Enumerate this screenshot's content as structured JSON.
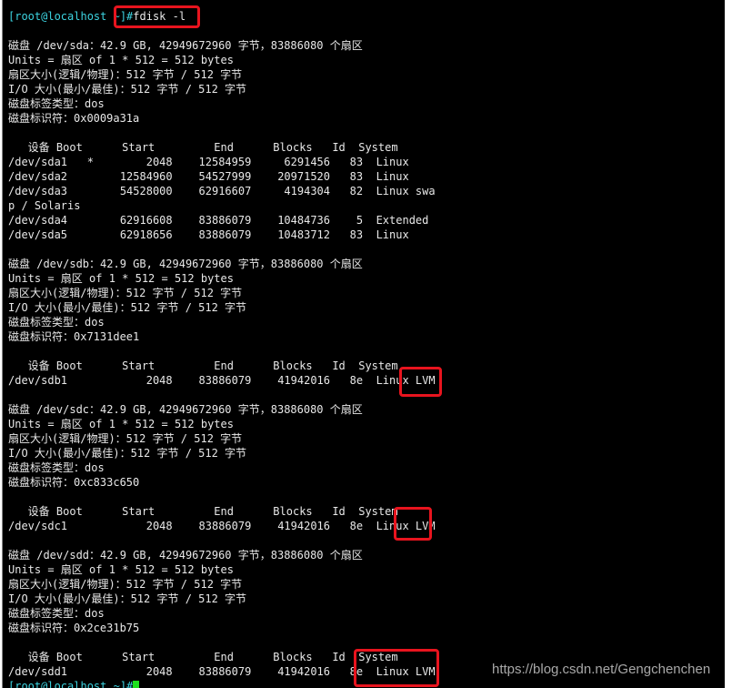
{
  "terminal": {
    "prompt": "[root@localhost ~]#",
    "command": "fdisk -l",
    "lines": [
      "磁盘 /dev/sda：42.9 GB, 42949672960 字节，83886080 个扇区",
      "Units = 扇区 of 1 * 512 = 512 bytes",
      "扇区大小(逻辑/物理)：512 字节 / 512 字节",
      "I/O 大小(最小/最佳)：512 字节 / 512 字节",
      "磁盘标签类型：dos",
      "磁盘标识符：0x0009a31a",
      "",
      "   设备 Boot      Start         End      Blocks   Id  System",
      "/dev/sda1   *        2048    12584959     6291456   83  Linux",
      "/dev/sda2        12584960    54527999    20971520   83  Linux",
      "/dev/sda3        54528000    62916607     4194304   82  Linux swa",
      "p / Solaris",
      "/dev/sda4        62916608    83886079    10484736    5  Extended",
      "/dev/sda5        62918656    83886079    10483712   83  Linux",
      "",
      "磁盘 /dev/sdb：42.9 GB, 42949672960 字节，83886080 个扇区",
      "Units = 扇区 of 1 * 512 = 512 bytes",
      "扇区大小(逻辑/物理)：512 字节 / 512 字节",
      "I/O 大小(最小/最佳)：512 字节 / 512 字节",
      "磁盘标签类型：dos",
      "磁盘标识符：0x7131dee1",
      "",
      "   设备 Boot      Start         End      Blocks   Id  System",
      "/dev/sdb1            2048    83886079    41942016   8e  Linux LVM",
      "",
      "磁盘 /dev/sdc：42.9 GB, 42949672960 字节，83886080 个扇区",
      "Units = 扇区 of 1 * 512 = 512 bytes",
      "扇区大小(逻辑/物理)：512 字节 / 512 字节",
      "I/O 大小(最小/最佳)：512 字节 / 512 字节",
      "磁盘标签类型：dos",
      "磁盘标识符：0xc833c650",
      "",
      "   设备 Boot      Start         End      Blocks   Id  System",
      "/dev/sdc1            2048    83886079    41942016   8e  Linux LVM",
      "",
      "磁盘 /dev/sdd：42.9 GB, 42949672960 字节，83886080 个扇区",
      "Units = 扇区 of 1 * 512 = 512 bytes",
      "扇区大小(逻辑/物理)：512 字节 / 512 字节",
      "I/O 大小(最小/最佳)：512 字节 / 512 字节",
      "磁盘标签类型：dos",
      "磁盘标识符：0x2ce31b75",
      "",
      "   设备 Boot      Start         End      Blocks   Id  System",
      "/dev/sdd1            2048    83886079    41942016   8e  Linux LVM"
    ],
    "final_prompt": "[root@localhost ~]#"
  },
  "watermark": "https://blog.csdn.net/Gengchenchen",
  "colors": {
    "background": "#000000",
    "text": "#e8e8e8",
    "prompt": "#3cd3e0",
    "highlight_box": "#e8141e",
    "cursor": "#1ee01e"
  }
}
